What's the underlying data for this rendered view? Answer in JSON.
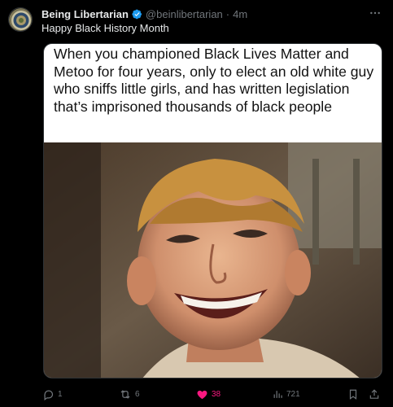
{
  "post": {
    "author_name": "Being Libertarian",
    "handle": "@beinlibertarian",
    "separator": "·",
    "time": "4m",
    "text": "Happy Black History Month"
  },
  "meme": {
    "caption": "When you championed Black Lives Matter and Metoo for four years, only to elect an old white guy who sniffs little girls, and has written legislation that’s imprisoned thousands of black people"
  },
  "actions": {
    "replies": "1",
    "reposts": "6",
    "likes": "38",
    "views": "721"
  },
  "colors": {
    "background": "#000000",
    "muted": "#71767b",
    "like": "#f91880",
    "verified": "#1d9bf0"
  },
  "icons": [
    "avatar-seal-icon",
    "verified-badge-icon",
    "more-icon",
    "reply-icon",
    "repost-icon",
    "heart-icon",
    "views-icon",
    "bookmark-icon",
    "share-icon"
  ]
}
